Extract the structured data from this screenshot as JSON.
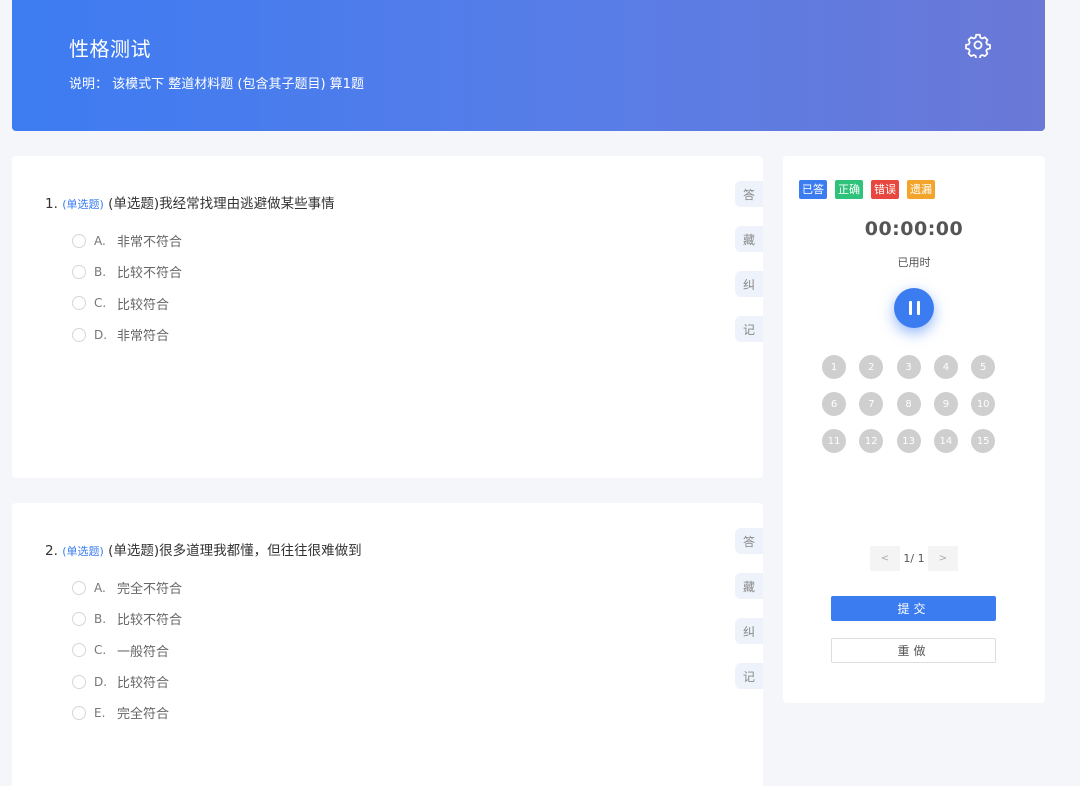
{
  "header": {
    "title": "性格测试",
    "description": "说明： 该模式下 整道材料题 (包含其子题目) 算1题"
  },
  "questions": [
    {
      "number": "1.",
      "type_tag": "(单选题)",
      "text": "(单选题)我经常找理由逃避做某些事情",
      "options": [
        {
          "letter": "A.",
          "text": "非常不符合"
        },
        {
          "letter": "B.",
          "text": "比较不符合"
        },
        {
          "letter": "C.",
          "text": "比较符合"
        },
        {
          "letter": "D.",
          "text": "非常符合"
        }
      ]
    },
    {
      "number": "2.",
      "type_tag": "(单选题)",
      "text": "(单选题)很多道理我都懂，但往往很难做到",
      "options": [
        {
          "letter": "A.",
          "text": "完全不符合"
        },
        {
          "letter": "B.",
          "text": "比较不符合"
        },
        {
          "letter": "C.",
          "text": "一般符合"
        },
        {
          "letter": "D.",
          "text": "比较符合"
        },
        {
          "letter": "E.",
          "text": "完全符合"
        }
      ]
    }
  ],
  "side_buttons": {
    "answer": "答",
    "collect": "藏",
    "correct": "纠",
    "note": "记"
  },
  "panel": {
    "legend": [
      {
        "label": "已答",
        "color": "#3b7cf0"
      },
      {
        "label": "正确",
        "color": "#2fc27a"
      },
      {
        "label": "错误",
        "color": "#e8473f"
      },
      {
        "label": "遗漏",
        "color": "#f3a52b"
      }
    ],
    "timer": "00:00:00",
    "timer_label": "已用时",
    "numbers": [
      "1",
      "2",
      "3",
      "4",
      "5",
      "6",
      "7",
      "8",
      "9",
      "10",
      "11",
      "12",
      "13",
      "14",
      "15"
    ],
    "pager": {
      "prev": "<",
      "info": "1/ 1",
      "next": ">"
    },
    "submit_label": "提交",
    "redo_label": "重做"
  }
}
